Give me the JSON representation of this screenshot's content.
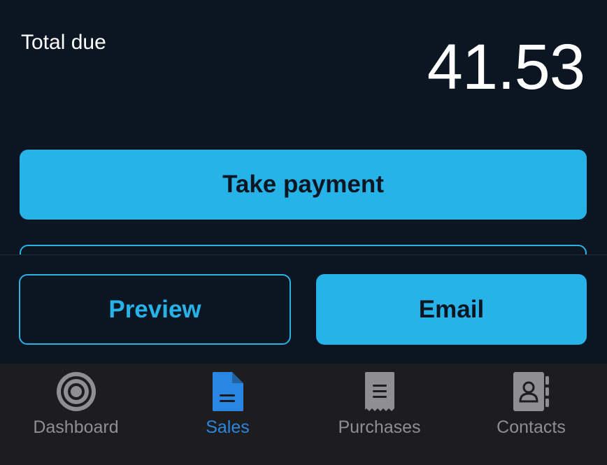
{
  "summary": {
    "total_label": "Total due",
    "total_amount": "41.53"
  },
  "actions": {
    "take_payment_label": "Take payment",
    "preview_label": "Preview",
    "email_label": "Email"
  },
  "tabbar": {
    "tabs": [
      {
        "label": "Dashboard",
        "icon": "target-icon",
        "active": false
      },
      {
        "label": "Sales",
        "icon": "document-icon",
        "active": true
      },
      {
        "label": "Purchases",
        "icon": "receipt-icon",
        "active": false
      },
      {
        "label": "Contacts",
        "icon": "contact-book-icon",
        "active": false
      }
    ]
  },
  "colors": {
    "background": "#0b1622",
    "accent": "#27b3e8",
    "tab_active": "#2a86e0",
    "tab_inactive": "#8e8e93",
    "tabbar_bg": "#1d1d1f"
  }
}
